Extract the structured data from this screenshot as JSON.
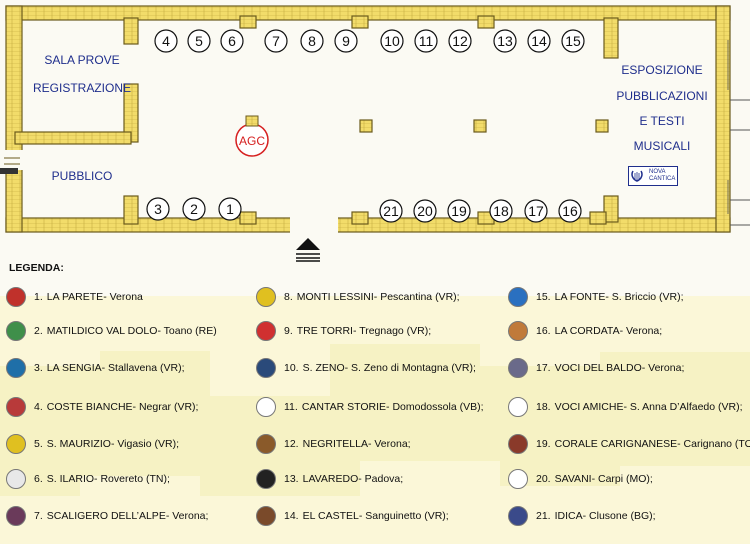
{
  "plan": {
    "left_room_top": [
      "SALA PROVE",
      "REGISTRAZIONE"
    ],
    "left_room_bottom": "PUBBLICO",
    "right_room": [
      "ESPOSIZIONE",
      "PUBBLICAZIONI",
      "E  TESTI",
      "MUSICALI"
    ],
    "center_mark": "AGC",
    "logo_text": [
      "NOVA",
      "CANTICA"
    ],
    "stands_top": [
      "4",
      "5",
      "6",
      "7",
      "8",
      "9",
      "10",
      "11",
      "12",
      "13",
      "14",
      "15"
    ],
    "stands_bottom_left": [
      "3",
      "2",
      "1"
    ],
    "stands_bottom_right": [
      "21",
      "20",
      "19",
      "18",
      "17",
      "16"
    ]
  },
  "legend": {
    "title": "LEGENDA:",
    "items": [
      {
        "num": "1.",
        "name": "LA PARETE",
        "place": " - Verona",
        "color": "#c0312b"
      },
      {
        "num": "2.",
        "name": "MATILDICO VAL DOLO",
        "place": " - Toano (RE)",
        "color": "#3f8f4a"
      },
      {
        "num": "3.",
        "name": "LA SENGIA",
        "place": " - Stallavena (VR);",
        "color": "#1f6fa8"
      },
      {
        "num": "4.",
        "name": "COSTE BIANCHE",
        "place": " - Negrar (VR);",
        "color": "#b83a3a"
      },
      {
        "num": "5.",
        "name": "S. MAURIZIO",
        "place": " - Vigasio (VR);",
        "color": "#e0c020"
      },
      {
        "num": "6.",
        "name": "S. ILARIO",
        "place": " - Rovereto (TN);",
        "color": "#e8e8e8"
      },
      {
        "num": "7.",
        "name": "SCALIGERO DELL’ALPE",
        "place": " - Verona;",
        "color": "#6a3a5a"
      },
      {
        "num": "8.",
        "name": "MONTI LESSINI",
        "place": " - Pescantina (VR);",
        "color": "#e0c020"
      },
      {
        "num": "9.",
        "name": "TRE TORRI",
        "place": " - Tregnago (VR);",
        "color": "#d03030"
      },
      {
        "num": "10.",
        "name": "S. ZENO",
        "place": " - S. Zeno di Montagna (VR);",
        "color": "#2a4a7a"
      },
      {
        "num": "11.",
        "name": "CANTAR STORIE",
        "place": " - Domodossola (VB);",
        "color": "#ffffff"
      },
      {
        "num": "12.",
        "name": "NEGRITELLA",
        "place": " - Verona;",
        "color": "#8a5a2a"
      },
      {
        "num": "13.",
        "name": "LAVAREDO",
        "place": " - Padova;",
        "color": "#222222"
      },
      {
        "num": "14.",
        "name": "EL CASTEL",
        "place": " - Sanguinetto (VR);",
        "color": "#7a4a2a"
      },
      {
        "num": "15.",
        "name": "LA FONTE",
        "place": " - S. Briccio (VR);",
        "color": "#2a70c0"
      },
      {
        "num": "16.",
        "name": "LA CORDATA",
        "place": " - Verona;",
        "color": "#c07a3a"
      },
      {
        "num": "17.",
        "name": "VOCI DEL BALDO",
        "place": " - Verona;",
        "color": "#6a6a8a"
      },
      {
        "num": "18.",
        "name": "VOCI AMICHE",
        "place": " - S. Anna D’Alfaedo (VR);",
        "color": "#ffffff"
      },
      {
        "num": "19.",
        "name": "CORALE CARIGNANESE",
        "place": " - Carignano (TO);",
        "color": "#8a3a2a"
      },
      {
        "num": "20.",
        "name": "SAVANI",
        "place": " - Carpi (MO);",
        "color": "#ffffff"
      },
      {
        "num": "21.",
        "name": "IDICA",
        "place": " - Clusone (BG);",
        "color": "#3a4a8a"
      }
    ]
  }
}
